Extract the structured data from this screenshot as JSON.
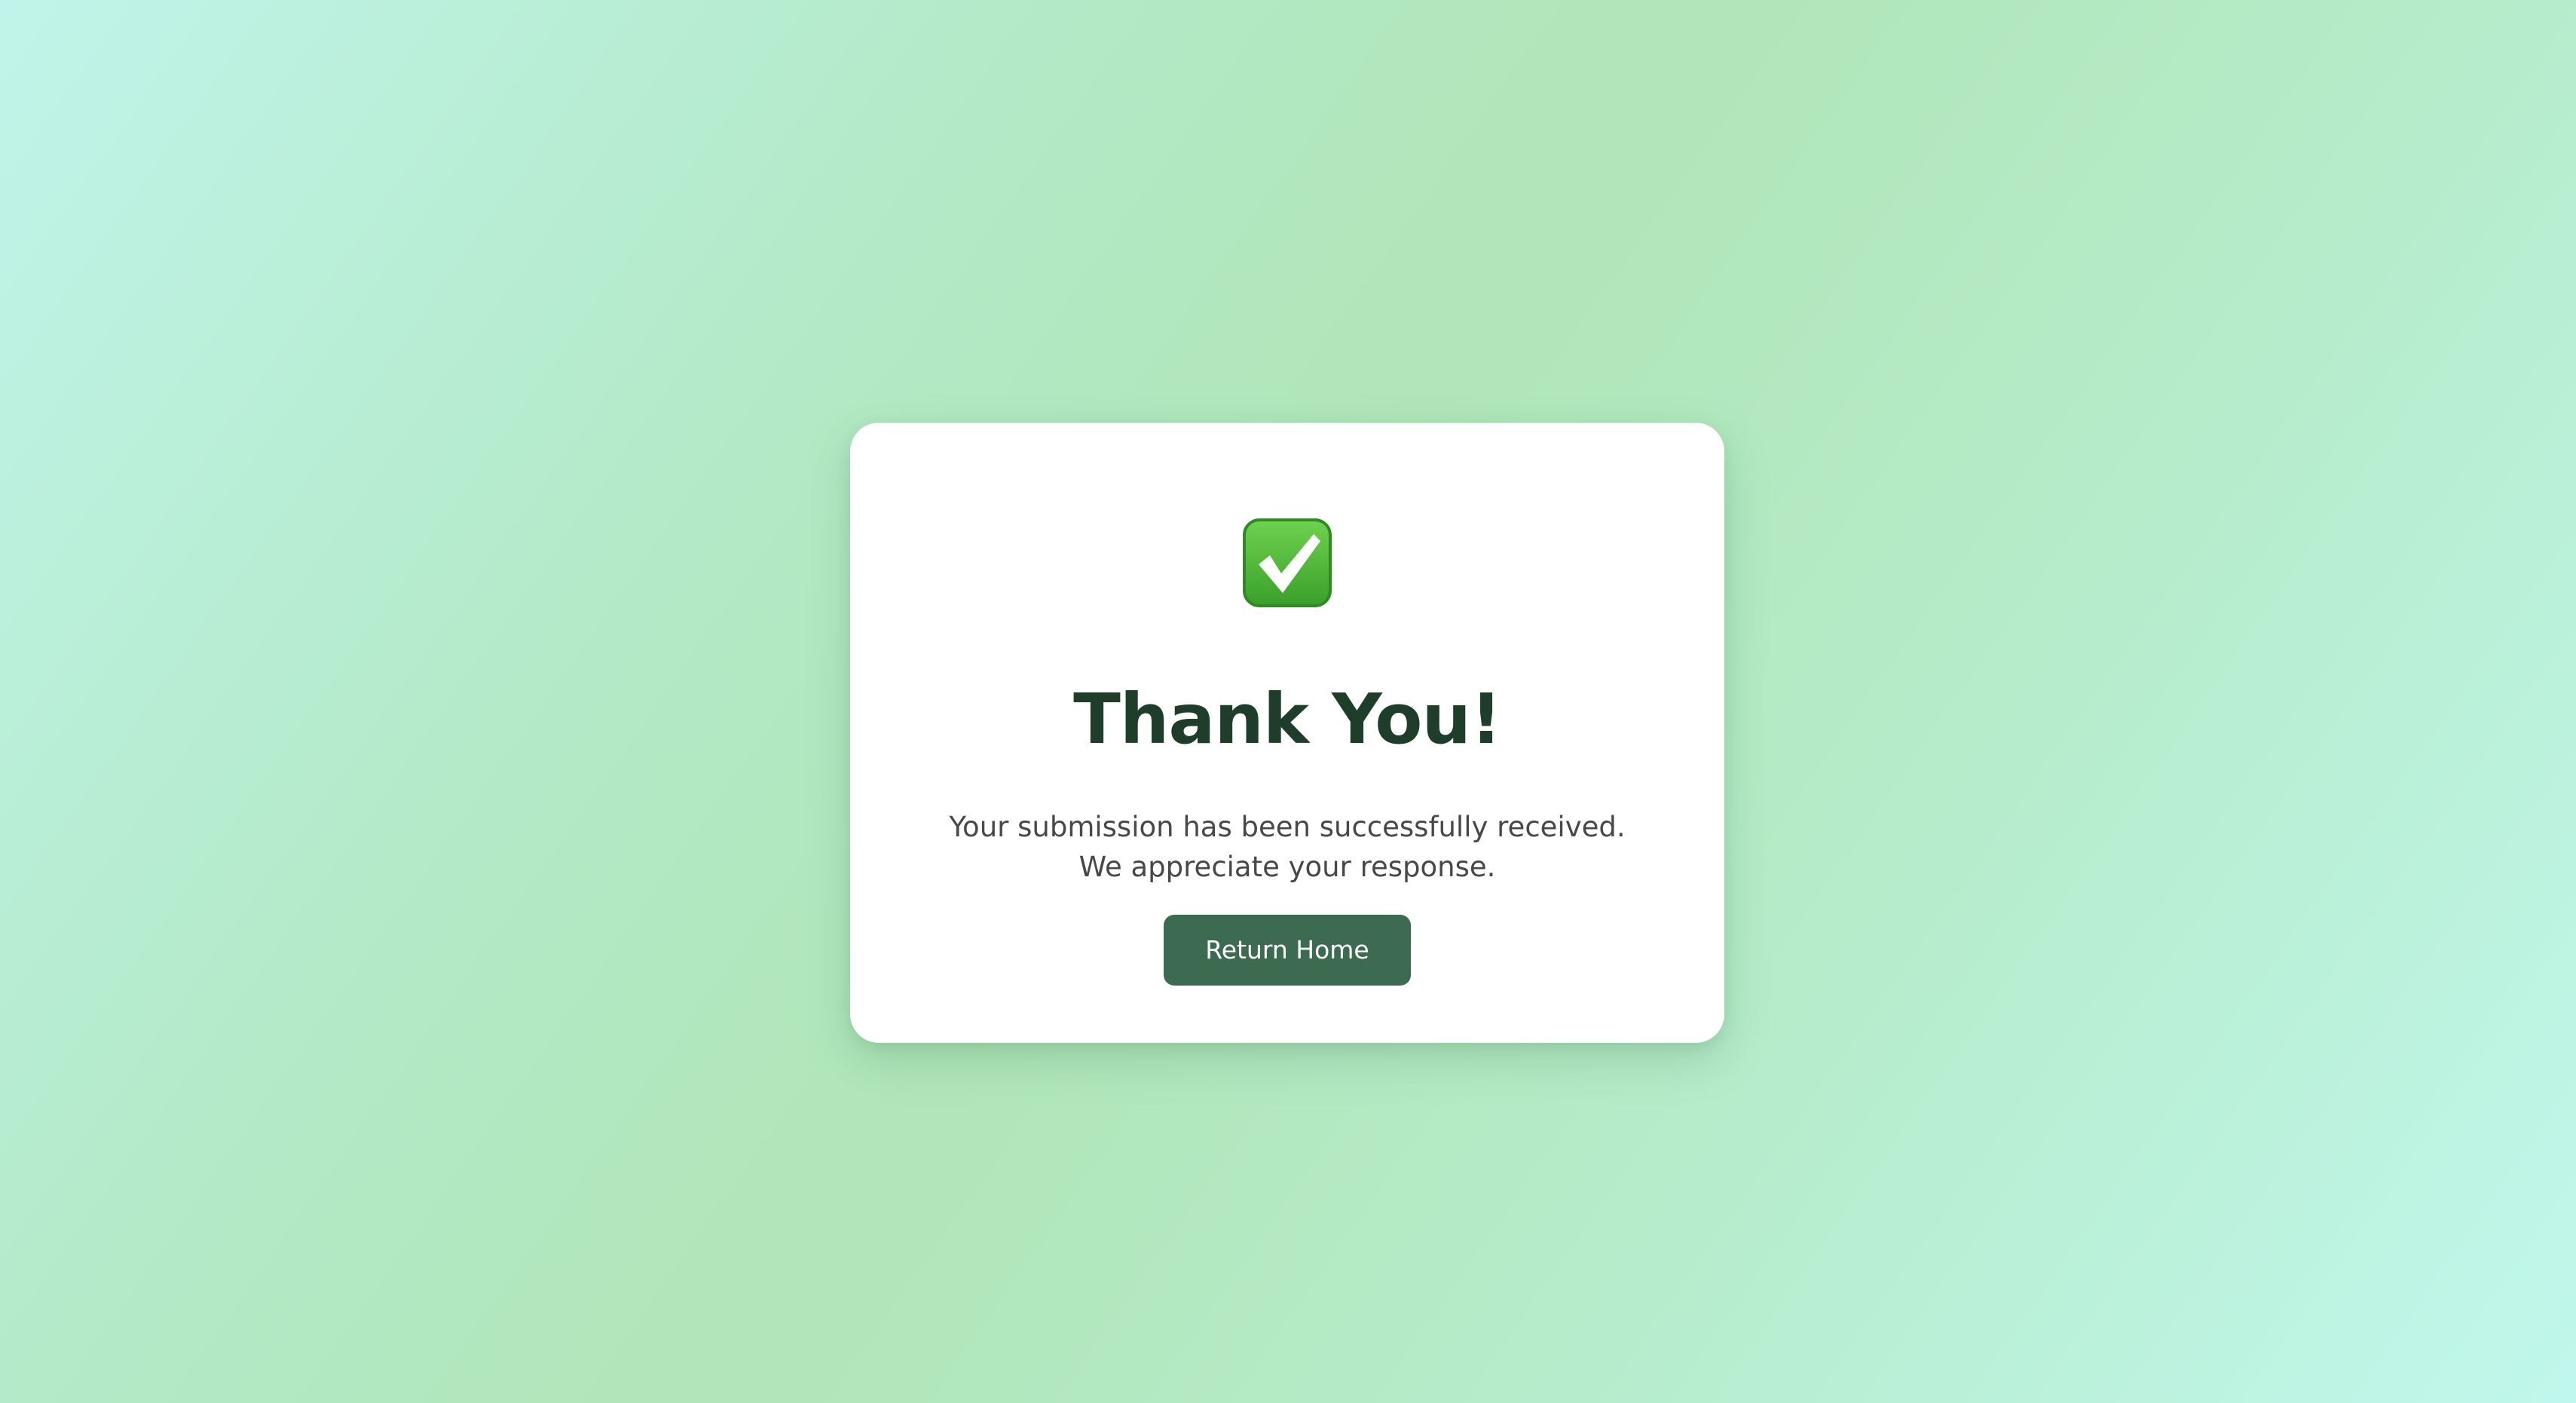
{
  "card": {
    "icon": "check-mark-button-icon",
    "title": "Thank You!",
    "message": "Your submission has been successfully received. We appreciate your response.",
    "button_label": "Return Home"
  },
  "colors": {
    "title": "#1e3d2b",
    "message": "#484848",
    "button_background": "#3d6b51",
    "button_text": "#ffffff",
    "icon_fill": "#4cb33a"
  }
}
